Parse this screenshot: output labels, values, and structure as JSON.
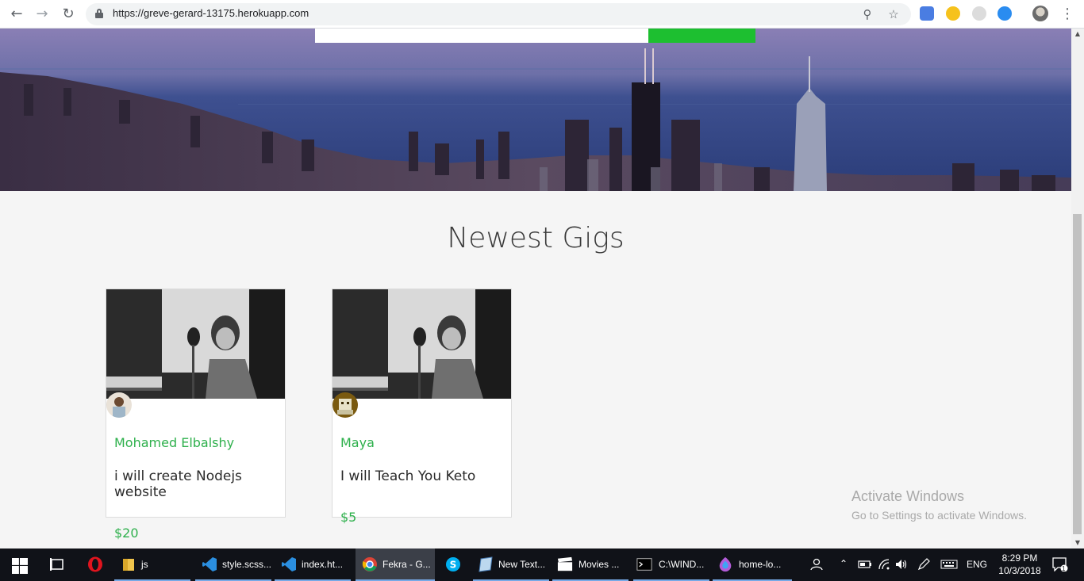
{
  "browser": {
    "url": "https://greve-gerard-13175.herokuapp.com",
    "back_icon": "arrow-left-icon",
    "forward_icon": "arrow-right-icon",
    "reload_icon": "reload-icon"
  },
  "hero": {
    "search_placeholder": "",
    "search_button_label": "",
    "search_button_color": "#1dbf30"
  },
  "section": {
    "title": "Newest Gigs"
  },
  "gigs": [
    {
      "seller": "Mohamed Elbalshy",
      "title": "i will create Nodejs website",
      "price": "$20"
    },
    {
      "seller": "Maya",
      "title": "I will Teach You Keto",
      "price": "$5"
    }
  ],
  "watermark": {
    "line1": "Activate Windows",
    "line2": "Go to Settings to activate Windows."
  },
  "taskbar": {
    "items": [
      {
        "label": "js"
      },
      {
        "label": "style.scss..."
      },
      {
        "label": "index.ht..."
      },
      {
        "label": "Fekra - G..."
      },
      {
        "label": "New Text..."
      },
      {
        "label": "Movies ..."
      },
      {
        "label": "C:\\WIND..."
      },
      {
        "label": "home-lo..."
      }
    ],
    "language": "ENG",
    "time": "8:29 PM",
    "date": "10/3/2018",
    "notification_count": "1"
  },
  "colors": {
    "accent_green": "#2eb04c",
    "taskbar_bg": "#101218"
  }
}
